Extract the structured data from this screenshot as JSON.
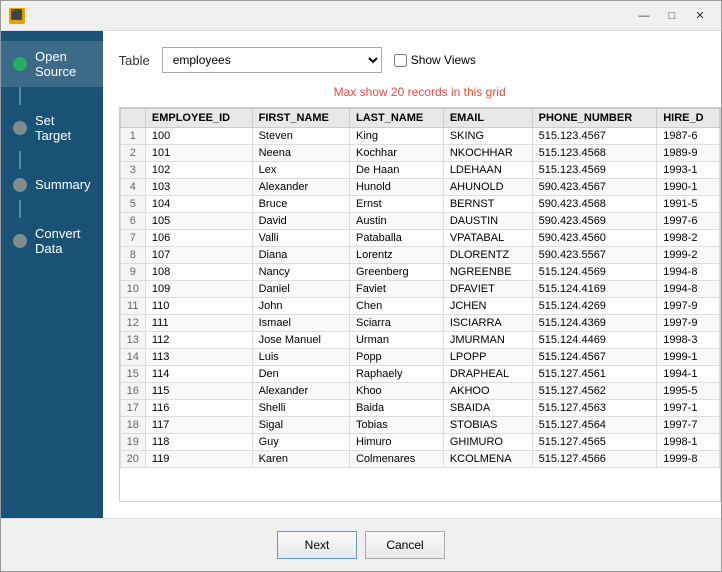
{
  "titlebar": {
    "icon": "🔶",
    "controls": {
      "minimize": "—",
      "maximize": "□",
      "close": "✕"
    }
  },
  "sidebar": {
    "items": [
      {
        "id": "open-source",
        "label": "Open Source",
        "dot": "green",
        "active": true
      },
      {
        "id": "set-target",
        "label": "Set Target",
        "dot": "gray"
      },
      {
        "id": "summary",
        "label": "Summary",
        "dot": "gray"
      },
      {
        "id": "convert-data",
        "label": "Convert Data",
        "dot": "gray"
      }
    ]
  },
  "main": {
    "table_label": "Table",
    "table_value": "employees",
    "show_views_label": "Show Views",
    "grid_info": "Max show 20 records in this grid",
    "columns": [
      "EMPLOYEE_ID",
      "FIRST_NAME",
      "LAST_NAME",
      "EMAIL",
      "PHONE_NUMBER",
      "HIRE_D"
    ],
    "rows": [
      [
        "100",
        "Steven",
        "King",
        "SKING",
        "515.123.4567",
        "1987-6"
      ],
      [
        "101",
        "Neena",
        "Kochhar",
        "NKOCHHAR",
        "515.123.4568",
        "1989-9"
      ],
      [
        "102",
        "Lex",
        "De Haan",
        "LDEHAAN",
        "515.123.4569",
        "1993-1"
      ],
      [
        "103",
        "Alexander",
        "Hunold",
        "AHUNOLD",
        "590.423.4567",
        "1990-1"
      ],
      [
        "104",
        "Bruce",
        "Ernst",
        "BERNST",
        "590.423.4568",
        "1991-5"
      ],
      [
        "105",
        "David",
        "Austin",
        "DAUSTIN",
        "590.423.4569",
        "1997-6"
      ],
      [
        "106",
        "Valli",
        "Pataballa",
        "VPATABAL",
        "590.423.4560",
        "1998-2"
      ],
      [
        "107",
        "Diana",
        "Lorentz",
        "DLORENTZ",
        "590.423.5567",
        "1999-2"
      ],
      [
        "108",
        "Nancy",
        "Greenberg",
        "NGREENBE",
        "515.124.4569",
        "1994-8"
      ],
      [
        "109",
        "Daniel",
        "Faviet",
        "DFAVIET",
        "515.124.4169",
        "1994-8"
      ],
      [
        "110",
        "John",
        "Chen",
        "JCHEN",
        "515.124.4269",
        "1997-9"
      ],
      [
        "111",
        "Ismael",
        "Sciarra",
        "ISCIARRA",
        "515.124.4369",
        "1997-9"
      ],
      [
        "112",
        "Jose Manuel",
        "Urman",
        "JMURMAN",
        "515.124.4469",
        "1998-3"
      ],
      [
        "113",
        "Luis",
        "Popp",
        "LPOPP",
        "515.124.4567",
        "1999-1"
      ],
      [
        "114",
        "Den",
        "Raphaely",
        "DRAPHEAL",
        "515.127.4561",
        "1994-1"
      ],
      [
        "115",
        "Alexander",
        "Khoo",
        "AKHOO",
        "515.127.4562",
        "1995-5"
      ],
      [
        "116",
        "Shelli",
        "Baida",
        "SBAIDA",
        "515.127.4563",
        "1997-1"
      ],
      [
        "117",
        "Sigal",
        "Tobias",
        "STOBIAS",
        "515.127.4564",
        "1997-7"
      ],
      [
        "118",
        "Guy",
        "Himuro",
        "GHIMURO",
        "515.127.4565",
        "1998-1"
      ],
      [
        "119",
        "Karen",
        "Colmenares",
        "KCOLMENA",
        "515.127.4566",
        "1999-8"
      ]
    ]
  },
  "footer": {
    "next_label": "Next",
    "cancel_label": "Cancel"
  }
}
